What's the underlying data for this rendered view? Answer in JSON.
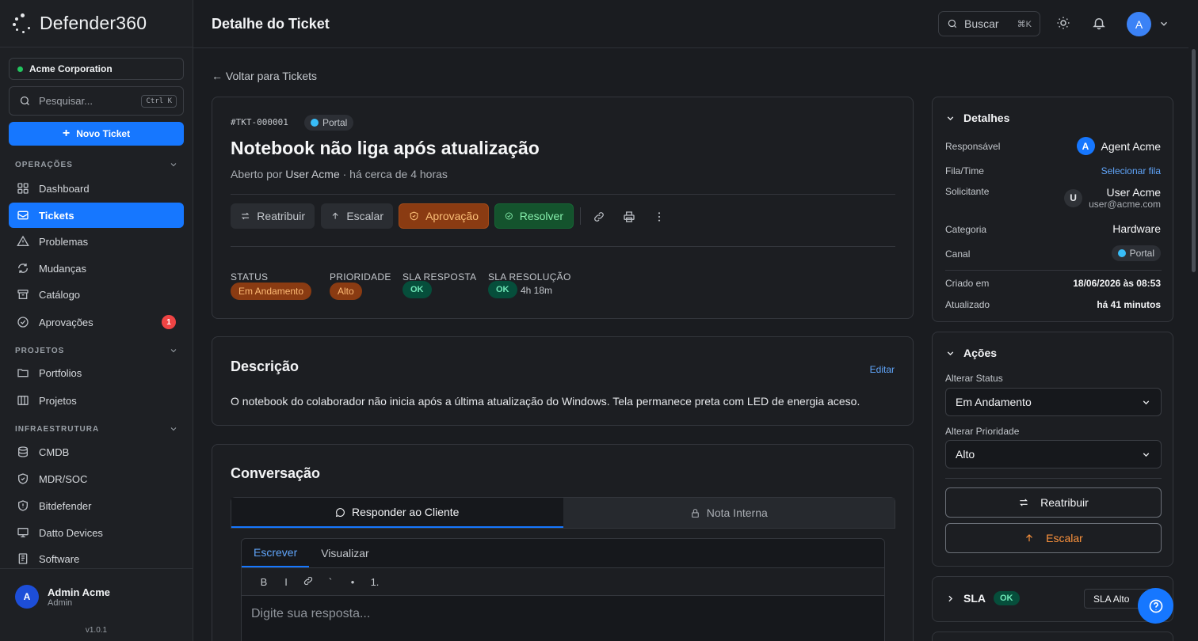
{
  "brand": {
    "name": "Defender360"
  },
  "sidebar": {
    "org": "Acme Corporation",
    "search_placeholder": "Pesquisar...",
    "search_kbd": "Ctrl K",
    "new_ticket": "Novo Ticket",
    "sections": [
      {
        "label": "OPERAÇÕES"
      },
      {
        "label": "PROJETOS"
      },
      {
        "label": "INFRAESTRUTURA"
      }
    ],
    "items": [
      {
        "label": "Dashboard",
        "icon": "grid-icon"
      },
      {
        "label": "Tickets",
        "icon": "ticket-icon",
        "active": true
      },
      {
        "label": "Problemas",
        "icon": "warning-icon"
      },
      {
        "label": "Mudanças",
        "icon": "refresh-icon"
      },
      {
        "label": "Catálogo",
        "icon": "archive-icon"
      },
      {
        "label": "Aprovações",
        "icon": "check-circle-icon",
        "badge": "1"
      },
      {
        "label": "Portfolios",
        "icon": "folder-icon"
      },
      {
        "label": "Projetos",
        "icon": "columns-icon"
      },
      {
        "label": "CMDB",
        "icon": "database-icon"
      },
      {
        "label": "MDR/SOC",
        "icon": "shield-icon"
      },
      {
        "label": "Bitdefender",
        "icon": "shield-alert-icon"
      },
      {
        "label": "Datto Devices",
        "icon": "monitor-icon"
      },
      {
        "label": "Software",
        "icon": "package-icon"
      }
    ],
    "user": {
      "initial": "A",
      "name": "Admin Acme",
      "role": "Admin"
    },
    "version": "v1.0.1"
  },
  "topbar": {
    "title": "Detalhe do Ticket",
    "search_label": "Buscar",
    "search_kbd": "⌘K",
    "avatar_initial": "A"
  },
  "main": {
    "back_link": "← Voltar para Tickets",
    "ticket": {
      "id": "#TKT-000001",
      "channel": "Portal",
      "title": "Notebook não liga após atualização",
      "opened_prefix": "Aberto por",
      "opened_by": "User Acme",
      "opened_suffix": "· há cerca de 4 horas",
      "actions": {
        "reassign": "Reatribuir",
        "escalate": "Escalar",
        "approval": "Aprovação",
        "resolve": "Resolver"
      },
      "meta": {
        "status_label": "STATUS",
        "status_value": "Em Andamento",
        "priority_label": "PRIORIDADE",
        "priority_value": "Alto",
        "sla_response_label": "SLA RESPOSTA",
        "sla_response_value": "OK",
        "sla_resolution_label": "SLA RESOLUÇÃO",
        "sla_resolution_value": "OK",
        "sla_resolution_time": "4h 18m"
      }
    },
    "description": {
      "title": "Descrição",
      "edit": "Editar",
      "text": "O notebook do colaborador não inicia após a última atualização do Windows. Tela permanece preta com LED de energia aceso."
    },
    "conversation": {
      "title": "Conversação",
      "tab_reply": "Responder ao Cliente",
      "tab_internal": "Nota Interna",
      "editor_write": "Escrever",
      "editor_preview": "Visualizar",
      "toolbar": [
        "B",
        "I",
        "link",
        "`",
        "•",
        "1."
      ],
      "placeholder": "Digite sua resposta..."
    }
  },
  "details": {
    "title": "Detalhes",
    "assignee_label": "Responsável",
    "assignee_initial": "A",
    "assignee": "Agent Acme",
    "queue_label": "Fila/Time",
    "queue_value": "Selecionar fila",
    "requester_label": "Solicitante",
    "requester_initial": "U",
    "requester": "User Acme",
    "requester_email": "user@acme.com",
    "category_label": "Categoria",
    "category": "Hardware",
    "channel_label": "Canal",
    "channel": "Portal",
    "created_label": "Criado em",
    "created": "18/06/2026 às 08:53",
    "updated_label": "Atualizado",
    "updated": "há 41 minutos"
  },
  "actions_panel": {
    "title": "Ações",
    "status_label": "Alterar Status",
    "status_value": "Em Andamento",
    "priority_label": "Alterar Prioridade",
    "priority_value": "Alto",
    "reassign": "Reatribuir",
    "escalate": "Escalar"
  },
  "sla_panel": {
    "title": "SLA",
    "badge": "OK",
    "select_value": "SLA Alto"
  },
  "colors": {
    "accent": "#1677ff",
    "warning": "#8a3b12",
    "success": "#14532d"
  }
}
